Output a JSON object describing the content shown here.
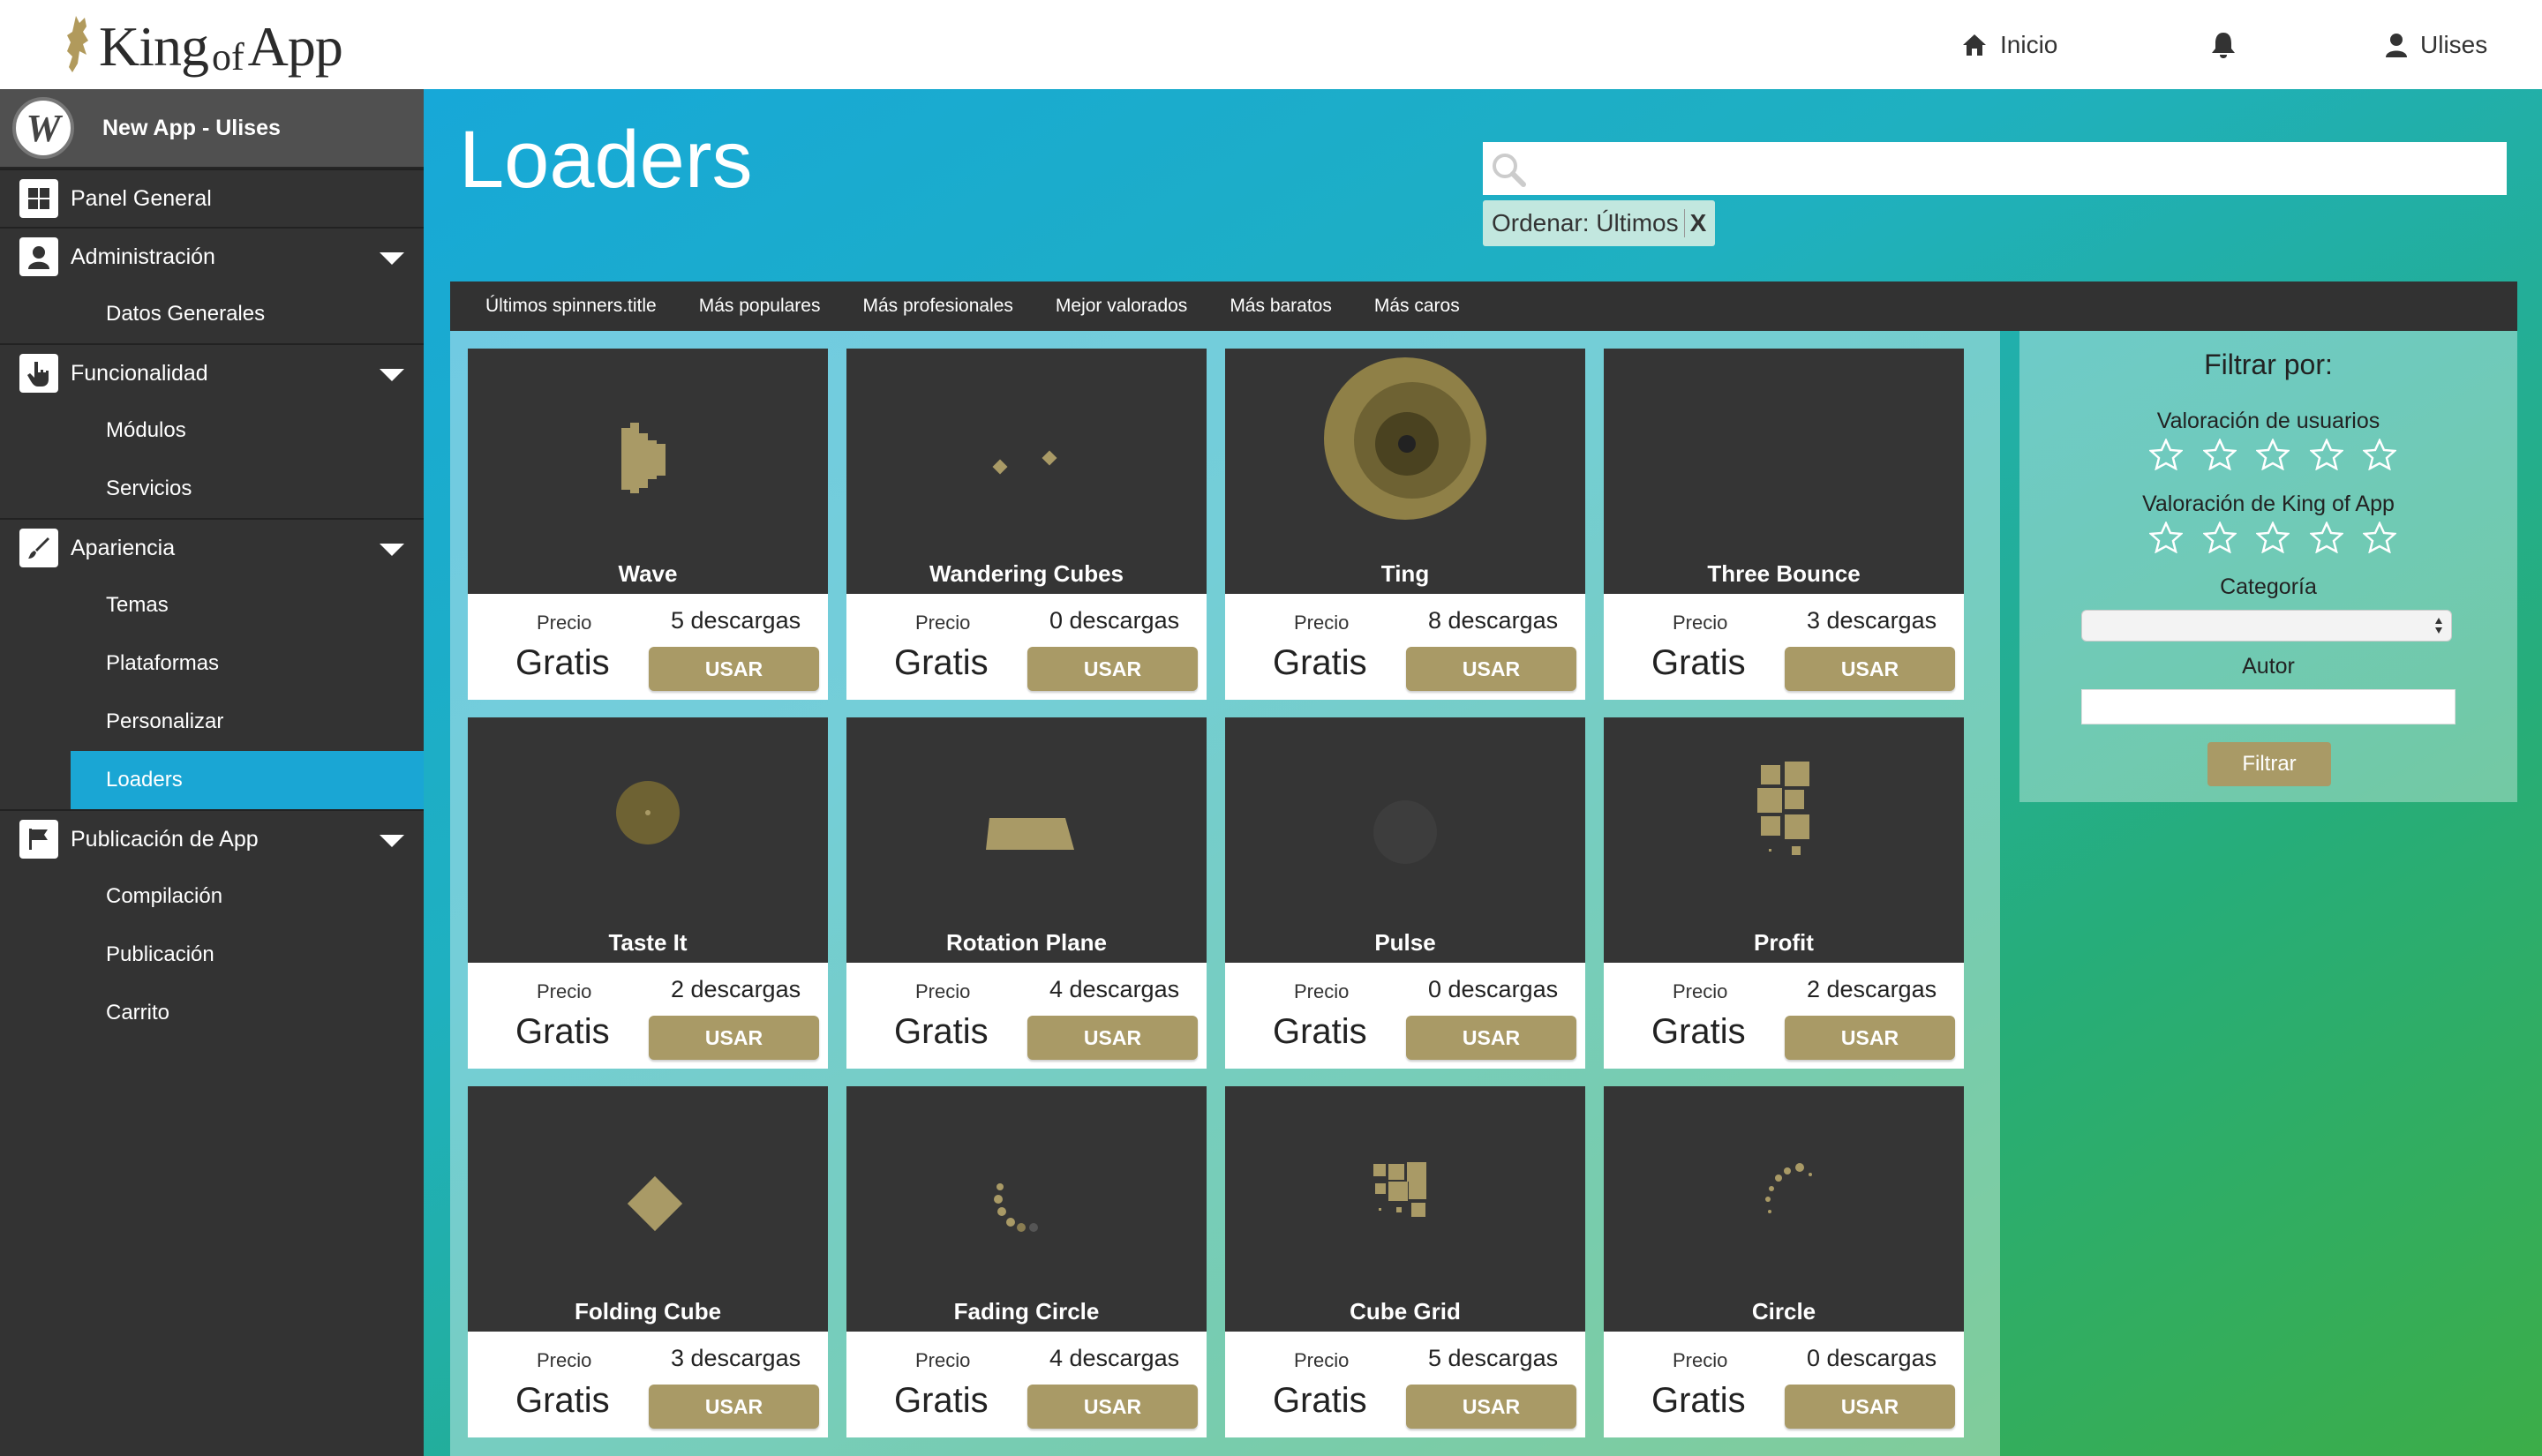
{
  "brand": {
    "king": "King",
    "of": "of",
    "app": "App"
  },
  "topnav": {
    "home": "Inicio",
    "user": "Ulises"
  },
  "sidebar": {
    "app_name": "New App - Ulises",
    "app_logo_letter": "W",
    "panel": "Panel General",
    "admin": "Administración",
    "datos": "Datos Generales",
    "func": "Funcionalidad",
    "modulos": "Módulos",
    "servicios": "Servicios",
    "apariencia": "Apariencia",
    "temas": "Temas",
    "plataformas": "Plataformas",
    "personalizar": "Personalizar",
    "loaders": "Loaders",
    "publicacion_app": "Publicación de App",
    "compilacion": "Compilación",
    "publicacion": "Publicación",
    "carrito": "Carrito"
  },
  "page": {
    "title": "Loaders",
    "search_value": "",
    "order_chip": "Ordenar: Últimos",
    "order_chip_close": "X"
  },
  "tabs": [
    "Últimos spinners.title",
    "Más populares",
    "Más profesionales",
    "Mejor valorados",
    "Más baratos",
    "Más caros"
  ],
  "cards": [
    {
      "name": "Wave",
      "downloads": "5 descargas"
    },
    {
      "name": "Wandering Cubes",
      "downloads": "0 descargas"
    },
    {
      "name": "Ting",
      "downloads": "8 descargas"
    },
    {
      "name": "Three Bounce",
      "downloads": "3 descargas"
    },
    {
      "name": "Taste It",
      "downloads": "2 descargas"
    },
    {
      "name": "Rotation Plane",
      "downloads": "4 descargas"
    },
    {
      "name": "Pulse",
      "downloads": "0 descargas"
    },
    {
      "name": "Profit",
      "downloads": "2 descargas"
    },
    {
      "name": "Folding Cube",
      "downloads": "3 descargas"
    },
    {
      "name": "Fading Circle",
      "downloads": "4 descargas"
    },
    {
      "name": "Cube Grid",
      "downloads": "5 descargas"
    },
    {
      "name": "Circle",
      "downloads": "0 descargas"
    }
  ],
  "card_labels": {
    "price_label": "Precio",
    "price": "Gratis",
    "use": "USAR"
  },
  "filter": {
    "title": "Filtrar por:",
    "user_rating": "Valoración de usuarios",
    "koa_rating": "Valoración de King of App",
    "category": "Categoría",
    "category_value": "",
    "author": "Autor",
    "author_value": "",
    "button": "Filtrar"
  },
  "colors": {
    "accent_gold": "#a99a66",
    "sidebar": "#333333",
    "active_item": "#1aa6d4",
    "tabs_bar": "#323232"
  }
}
